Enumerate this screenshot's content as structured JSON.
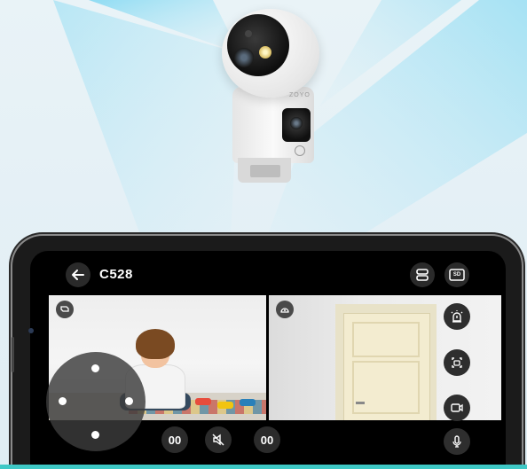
{
  "app": {
    "title": "C528",
    "camera_logo_text": "ZOYO"
  },
  "header": {
    "back_icon": "arrow-left-icon",
    "layout_icon": "split-layout-icon",
    "quality_icon": "sd-quality-icon",
    "quality_label": "SD"
  },
  "feeds": {
    "left": {
      "badge_icon": "pan-tilt-camera-icon"
    },
    "right": {
      "badge_icon": "fixed-camera-icon"
    }
  },
  "side_actions": [
    {
      "name": "alarm-siren-button",
      "icon": "siren-icon"
    },
    {
      "name": "snapshot-button",
      "icon": "screenshot-icon"
    },
    {
      "name": "record-button",
      "icon": "video-record-icon"
    },
    {
      "name": "talk-button",
      "icon": "microphone-icon"
    }
  ],
  "bottom_controls": {
    "left_pause_label": "00",
    "right_pause_label": "00",
    "mute_icon": "muted-speaker-icon"
  },
  "colors": {
    "accent_teal": "#3fc9c6",
    "beam_blue": "#6fd2ef",
    "phone_body": "#1b1b1b"
  }
}
